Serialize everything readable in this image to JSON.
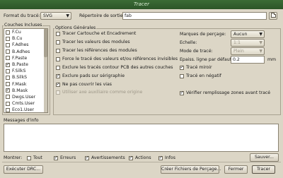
{
  "window": {
    "title": "Tracer"
  },
  "top": {
    "format_label": "Format du tracé:",
    "format_value": "SVG",
    "output_dir_label": "Répertoire de sortie:",
    "output_dir_value": "fab"
  },
  "layers": {
    "group_title": "Couches Incluses",
    "items": [
      {
        "label": "F.Cu",
        "checked": false
      },
      {
        "label": "B.Cu",
        "checked": false
      },
      {
        "label": "F.Adhes",
        "checked": false
      },
      {
        "label": "B.Adhes",
        "checked": false
      },
      {
        "label": "F.Paste",
        "checked": false
      },
      {
        "label": "B.Paste",
        "checked": true
      },
      {
        "label": "F.SilkS",
        "checked": false
      },
      {
        "label": "B.SilkS",
        "checked": false
      },
      {
        "label": "F.Mask",
        "checked": false
      },
      {
        "label": "B.Mask",
        "checked": true
      },
      {
        "label": "Dwgs.User",
        "checked": false
      },
      {
        "label": "Cmts.User",
        "checked": false
      },
      {
        "label": "Eco1.User",
        "checked": false
      }
    ]
  },
  "options": {
    "group_title": "Options Générales",
    "left": [
      {
        "label": "Tracer Cartouche et Encadrement",
        "checked": false,
        "disabled": false
      },
      {
        "label": "Tracer les valeurs des modules",
        "checked": false,
        "disabled": false
      },
      {
        "label": "Tracer les références des modules",
        "checked": false,
        "disabled": false
      },
      {
        "label": "Force le tracé des valeurs et/ou références invisibles",
        "checked": false,
        "disabled": false
      },
      {
        "label": "Exclure les tracés contour PCB des autres couches",
        "checked": false,
        "disabled": false
      },
      {
        "label": "Exclure pads sur sérigraphie",
        "checked": true,
        "disabled": false
      },
      {
        "label": "Ne pas couvrir les vias",
        "checked": true,
        "disabled": false
      },
      {
        "label": "Utiliser axe auxiliaire comme origine",
        "checked": false,
        "disabled": true
      }
    ],
    "drill_marks_label": "Marques de perçage:",
    "drill_marks_value": "Aucun",
    "scale_label": "Echelle:",
    "scale_value": "1:1",
    "plot_mode_label": "Mode de tracé:",
    "plot_mode_value": "Plein",
    "line_width_label": "Epaiss. ligne par défaut:",
    "line_width_value": "0.2",
    "line_width_unit": "mm",
    "mirror_label": "Tracé miroir",
    "mirror_checked": true,
    "negative_label": "Tracé en négatif",
    "negative_checked": false,
    "zone_fill_label": "Vérifier remplissage zones avant tracé",
    "zone_fill_checked": true
  },
  "messages": {
    "title": "Messages d'info",
    "show_label": "Montrer:",
    "filters": [
      {
        "label": "Tout",
        "checked": false
      },
      {
        "label": "Erreurs",
        "checked": true
      },
      {
        "label": "Avertissements",
        "checked": true
      },
      {
        "label": "Actions",
        "checked": true
      },
      {
        "label": "Infos",
        "checked": true
      }
    ],
    "save_button": "Sauver..."
  },
  "buttons": {
    "drill": "Exécuter DRC...",
    "drill_files": "Créer Fichiers de Perçage...",
    "close": "Fermer",
    "plot": "Tracer"
  }
}
